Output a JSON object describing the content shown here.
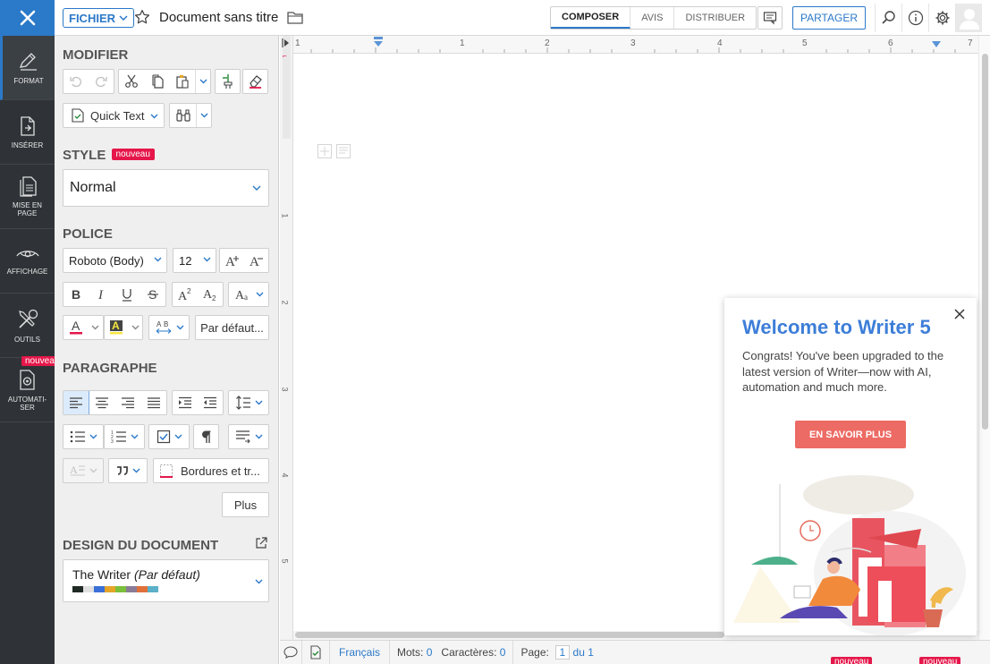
{
  "topbar": {
    "fichier_label": "FICHIER",
    "doc_title": "Document sans titre",
    "tabs": [
      {
        "label": "COMPOSER",
        "active": true
      },
      {
        "label": "AVIS",
        "active": false
      },
      {
        "label": "DISTRIBUER",
        "active": false
      }
    ],
    "share_label": "PARTAGER"
  },
  "leftnav": {
    "items": [
      {
        "label": "FORMAT",
        "icon": "pen-icon",
        "active": true
      },
      {
        "label": "INSÉRER",
        "icon": "insert-doc-icon"
      },
      {
        "label": "MISE EN PAGE",
        "icon": "page-layout-icon"
      },
      {
        "label": "AFFICHAGE",
        "icon": "eye-icon"
      },
      {
        "label": "OUTILS",
        "icon": "tools-icon"
      },
      {
        "label": "AUTOMATI-SER",
        "icon": "automate-icon",
        "badge": "nouveau"
      }
    ]
  },
  "panel": {
    "modifier_title": "MODIFIER",
    "quick_text_label": "Quick Text",
    "style_title": "STYLE",
    "style_badge": "nouveau",
    "style_value": "Normal",
    "police_title": "POLICE",
    "font_value": "Roboto (Body)",
    "size_value": "12",
    "par_defaut_label": "Par défaut...",
    "paragraphe_title": "PARAGRAPHE",
    "bordures_label": "Bordures et tr...",
    "plus_label": "Plus",
    "design_title": "DESIGN DU DOCUMENT",
    "theme_name": "The Writer",
    "theme_default": "(Par défaut)",
    "theme_swatches": [
      "#1f2a24",
      "#e0e0e0",
      "#3a6fd8",
      "#e6a428",
      "#7bbf3a",
      "#8a7c98",
      "#e0703a",
      "#5ab0c8"
    ]
  },
  "ruler": {
    "h_numbers": [
      "1",
      "1",
      "2",
      "3",
      "4",
      "5",
      "6",
      "7"
    ],
    "v_numbers": [
      "1",
      "1",
      "2",
      "3",
      "4",
      "5"
    ]
  },
  "popup": {
    "title": "Welcome to Writer 5",
    "body": "Congrats! You've been upgraded to the latest version of Writer—now with AI, automation and much more.",
    "cta_label": "EN SAVOIR PLUS"
  },
  "statusbar": {
    "language": "Français",
    "words_label": "Mots:",
    "words_value": "0",
    "chars_label": "Caractères:",
    "chars_value": "0",
    "page_label": "Page:",
    "page_value": "1",
    "page_total": "du 1",
    "badge1": "nouveau",
    "badge2": "nouveau"
  },
  "colors": {
    "accent": "#2b79c9",
    "sidebar_bg": "#2f3337",
    "badge": "#e5174a",
    "cta": "#ec6b64"
  }
}
